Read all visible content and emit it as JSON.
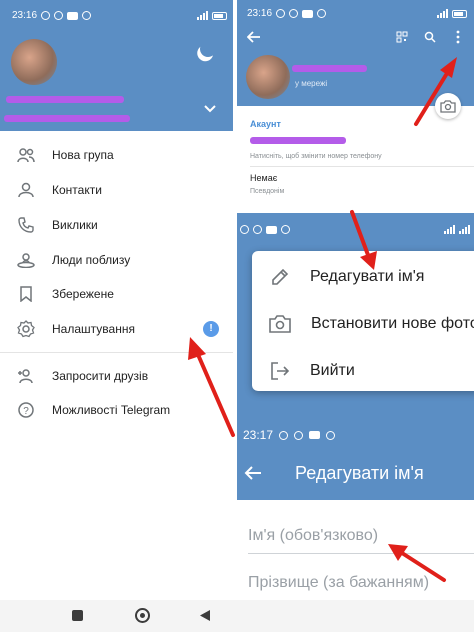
{
  "colors": {
    "header": "#5b8ec4",
    "accent": "#4a8fd6",
    "arrow": "#e0201a",
    "badge": "#5a9be8",
    "highlight": "#b45ce9"
  },
  "left": {
    "status_time": "23:16",
    "menu": [
      {
        "label": "Нова група",
        "icon": "group-icon"
      },
      {
        "label": "Контакти",
        "icon": "contact-icon"
      },
      {
        "label": "Виклики",
        "icon": "phone-icon"
      },
      {
        "label": "Люди поблизу",
        "icon": "nearby-icon"
      },
      {
        "label": "Збережене",
        "icon": "bookmark-icon"
      },
      {
        "label": "Налаштування",
        "icon": "settings-icon",
        "badge": "!"
      },
      {
        "label": "Запросити друзів",
        "icon": "add-user-icon"
      },
      {
        "label": "Можливості Telegram",
        "icon": "help-icon"
      }
    ]
  },
  "right": {
    "status_time": "23:16",
    "status": "у мережі",
    "account_title": "Акаунт",
    "phone_hint": "Натисніть, щоб змінити номер телефону",
    "username_value": "Немає",
    "username_label": "Псевдонім"
  },
  "popup": {
    "items": [
      {
        "label": "Редагувати ім'я",
        "icon": "pencil-icon"
      },
      {
        "label": "Встановити нове фото",
        "icon": "camera-add-icon"
      },
      {
        "label": "Вийти",
        "icon": "logout-icon"
      }
    ]
  },
  "edit": {
    "status_time": "23:17",
    "title": "Редагувати ім'я",
    "first_name_placeholder": "Ім'я (обов'язково)",
    "last_name_placeholder": "Прізвище (за бажанням)"
  }
}
